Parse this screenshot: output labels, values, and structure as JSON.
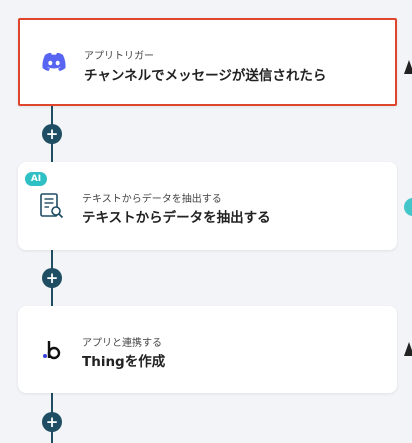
{
  "steps": [
    {
      "subtitle": "アプリトリガー",
      "title": "チャンネルでメッセージが送信されたら",
      "icon": "discord-icon",
      "selected": true
    },
    {
      "subtitle": "テキストからデータを抽出する",
      "title": "テキストからデータを抽出する",
      "icon": "document-search-icon",
      "badge": "AI"
    },
    {
      "subtitle": "アプリと連携する",
      "title": "Thingを作成",
      "icon": "bubble-b-icon"
    }
  ],
  "add_button_label": "+",
  "colors": {
    "accent": "#e0462d",
    "line": "#1f4d63",
    "discord": "#5865f2",
    "ai_badge": "#2ec0c4"
  }
}
